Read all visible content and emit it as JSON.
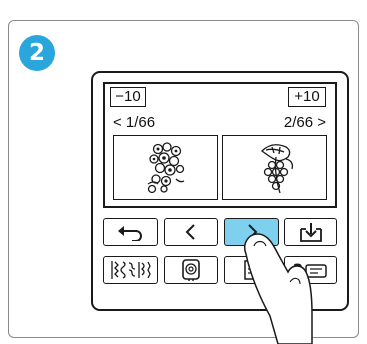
{
  "step": {
    "number": "2",
    "color": "#2aa6dc"
  },
  "pagination": {
    "minus_label": "−10",
    "plus_label": "+10",
    "current_page": "< 1/66",
    "next_page": "2/66 >"
  },
  "thumbnails": [
    {
      "name": "floral-cluster-embroidery"
    },
    {
      "name": "leaf-grapes-embroidery"
    }
  ],
  "toolbar": {
    "row1": [
      {
        "icon": "return-arrow-icon"
      },
      {
        "icon": "chevron-left-icon"
      },
      {
        "icon": "chevron-right-icon",
        "state": "pressed"
      },
      {
        "icon": "memory-save-icon"
      }
    ],
    "row2": [
      {
        "icon": "stitch-pattern-icon"
      },
      {
        "icon": "embroidery-hoop-icon"
      },
      {
        "icon": "list-icon"
      },
      {
        "icon": "help-icon",
        "label": "?"
      }
    ]
  },
  "colors": {
    "accent": "#7dd0ee",
    "badge": "#2aa6dc",
    "outline": "#1a1a1a"
  }
}
